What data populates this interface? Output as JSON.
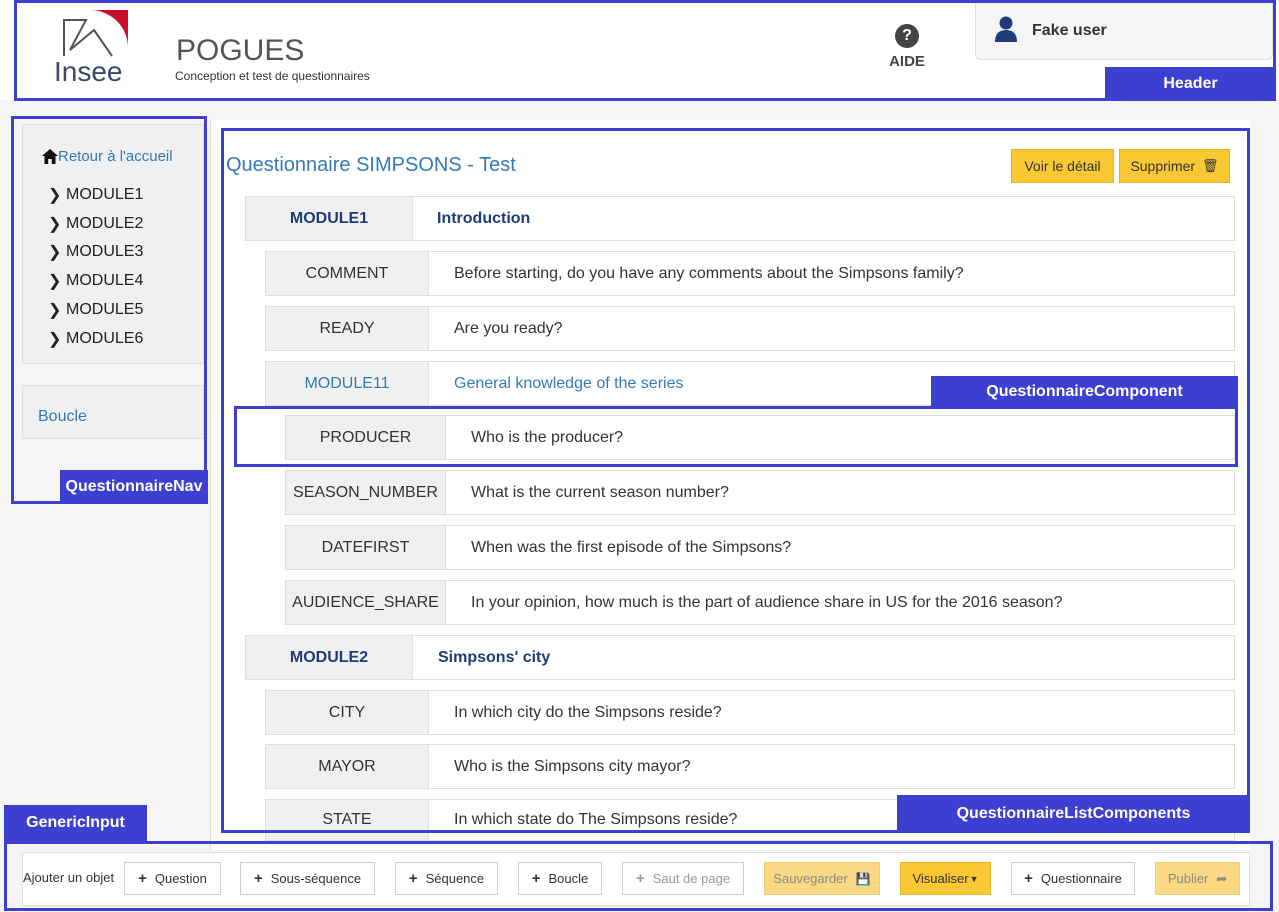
{
  "header": {
    "logo_text": "Insee",
    "app_title": "POGUES",
    "app_subtitle": "Conception et test de questionnaires",
    "help_label": "AIDE",
    "user_name": "Fake user",
    "annotation": "Header"
  },
  "nav": {
    "home_label": "Retour à l'accueil",
    "modules": [
      "MODULE1",
      "MODULE2",
      "MODULE3",
      "MODULE4",
      "MODULE5",
      "MODULE6"
    ],
    "loop_label": "Boucle",
    "annotation": "QuestionnaireNav"
  },
  "main": {
    "title": "Questionnaire SIMPSONS - Test",
    "detail_button": "Voir le détail",
    "delete_button": "Supprimer",
    "rows": [
      {
        "code": "MODULE1",
        "label": "Introduction",
        "kind": "module"
      },
      {
        "code": "COMMENT",
        "label": "Before starting, do you have any comments about the Simpsons family?",
        "kind": "question"
      },
      {
        "code": "READY",
        "label": "Are you ready?",
        "kind": "question"
      },
      {
        "code": "MODULE11",
        "label": "General knowledge of the series",
        "kind": "seq"
      },
      {
        "code": "PRODUCER",
        "label": "Who is the producer?",
        "kind": "question"
      },
      {
        "code": "SEASON_NUMBER",
        "label": "What is the current season number?",
        "kind": "question"
      },
      {
        "code": "DATEFIRST",
        "label": "When was the first episode of the Simpsons?",
        "kind": "question"
      },
      {
        "code": "AUDIENCE_SHARE",
        "label": "In your opinion, how much is the part of audience share in US for the 2016 season?",
        "kind": "question"
      },
      {
        "code": "MODULE2",
        "label": "Simpsons' city",
        "kind": "module"
      },
      {
        "code": "CITY",
        "label": "In which city do the Simpsons reside?",
        "kind": "question"
      },
      {
        "code": "MAYOR",
        "label": "Who is the Simpsons city mayor?",
        "kind": "question"
      },
      {
        "code": "STATE",
        "label": "In which state do The Simpsons reside?",
        "kind": "question"
      }
    ],
    "annotation_component": "QuestionnaireComponent",
    "annotation_list": "QuestionnaireListComponents"
  },
  "footer": {
    "add_label": "Ajouter un objet",
    "question": "Question",
    "subsequence": "Sous-séquence",
    "sequence": "Séquence",
    "loop": "Boucle",
    "page_break": "Saut de page",
    "save": "Sauvegarder",
    "visualize": "Visualiser",
    "questionnaire": "Questionnaire",
    "publish": "Publier",
    "annotation": "GenericInput"
  },
  "colors": {
    "annotation": "#3c3fcf",
    "link": "#337ab7",
    "accent": "#f9c832"
  }
}
